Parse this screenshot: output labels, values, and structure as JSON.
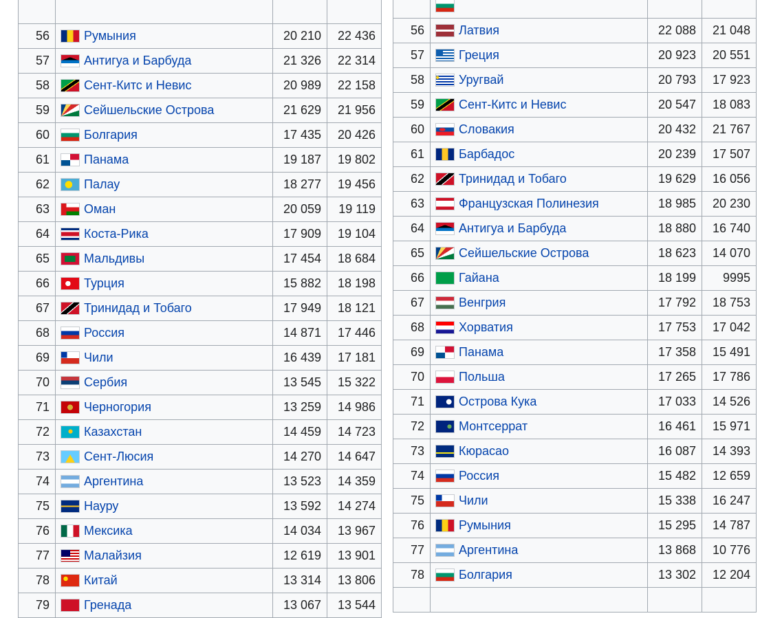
{
  "left_table": {
    "rows": [
      {
        "rank": "",
        "country": "",
        "v1": "",
        "v2": "",
        "flag": "none"
      },
      {
        "rank": "56",
        "country": "Румыния",
        "v1": "20 210",
        "v2": "22 436",
        "flag": "linear-gradient(90deg,#002b7f 33.3%,#fcd116 33.3% 66.6%,#ce1126 66.6%)"
      },
      {
        "rank": "57",
        "country": "Антигуа и Барбуда",
        "v1": "21 326",
        "v2": "22 314",
        "flag": "linear-gradient(160deg,#ce1126 30%,transparent 30%),linear-gradient(200deg,#ce1126 30%,transparent 30%),linear-gradient(180deg,#000 45%,#0072c6 45% 70%,#fff 70%)"
      },
      {
        "rank": "58",
        "country": "Сент-Китс и Невис",
        "v1": "20 989",
        "v2": "22 158",
        "flag": "linear-gradient(145deg,#009e49 38%,#fcd116 38% 42%,#000 42% 58%,#fcd116 58% 62%,#ce1126 62%)"
      },
      {
        "rank": "59",
        "country": "Сейшельские Острова",
        "v1": "21 629",
        "v2": "21 956",
        "flag": "conic-gradient(from 0deg at 0% 100%,#003f87 0deg 22deg,#fcd856 22deg 40deg,#d62828 40deg 57deg,#fff 57deg 72deg,#007a3d 72deg 90deg)"
      },
      {
        "rank": "60",
        "country": "Болгария",
        "v1": "17 435",
        "v2": "20 426",
        "flag": "linear-gradient(180deg,#fff 33.3%,#00966e 33.3% 66.6%,#d62612 66.6%)"
      },
      {
        "rank": "61",
        "country": "Панама",
        "v1": "19 187",
        "v2": "19 802",
        "flag": "linear-gradient(90deg,#fff 50%,#d21034 50%) top/100% 50% no-repeat,linear-gradient(90deg,#005293 50%,#fff 50%) bottom/100% 50% no-repeat"
      },
      {
        "rank": "62",
        "country": "Палау",
        "v1": "18 277",
        "v2": "19 456",
        "flag": "radial-gradient(circle at 42% 50%,#ffde00 30%,#4aadd6 31%)"
      },
      {
        "rank": "63",
        "country": "Оман",
        "v1": "20 059",
        "v2": "19 119",
        "flag": "linear-gradient(90deg,#db161b 28%,transparent 28%),linear-gradient(180deg,#fff 33.3%,#db161b 33.3% 66.6%,#008000 66.6%)"
      },
      {
        "rank": "64",
        "country": "Коста-Рика",
        "v1": "17 909",
        "v2": "19 104",
        "flag": "linear-gradient(180deg,#002b7f 16.6%,#fff 16.6% 33.3%,#ce1126 33.3% 66.6%,#fff 66.6% 83.3%,#002b7f 83.3%)"
      },
      {
        "rank": "65",
        "country": "Мальдивы",
        "v1": "17 454",
        "v2": "18 684",
        "flag": "linear-gradient(#007e3a,#007e3a) center/60% 55% no-repeat,#d21034"
      },
      {
        "rank": "66",
        "country": "Турция",
        "v1": "15 882",
        "v2": "18 198",
        "flag": "radial-gradient(circle at 38% 50%,#fff 20%,transparent 21%),#e30a17"
      },
      {
        "rank": "67",
        "country": "Тринидад и Тобаго",
        "v1": "17 949",
        "v2": "18 121",
        "flag": "linear-gradient(140deg,#ce1126 36%,#fff 36% 40%,#000 40% 60%,#fff 60% 64%,#ce1126 64%)"
      },
      {
        "rank": "68",
        "country": "Россия",
        "v1": "14 871",
        "v2": "17 446",
        "flag": "linear-gradient(180deg,#fff 33.3%,#0039a6 33.3% 66.6%,#d52b1e 66.6%)"
      },
      {
        "rank": "69",
        "country": "Чили",
        "v1": "16 439",
        "v2": "17 181",
        "flag": "linear-gradient(90deg,#0039a6 33%,#fff 33%) top/100% 50% no-repeat,linear-gradient(#d52b1e,#d52b1e) bottom/100% 50% no-repeat"
      },
      {
        "rank": "70",
        "country": "Сербия",
        "v1": "13 545",
        "v2": "15 322",
        "flag": "linear-gradient(180deg,#c6363c 33.3%,#0c4076 33.3% 66.6%,#fff 66.6%)"
      },
      {
        "rank": "71",
        "country": "Черногория",
        "v1": "13 259",
        "v2": "14 986",
        "flag": "radial-gradient(circle at 50% 50%,#d4af37 25%,transparent 26%),#c40308"
      },
      {
        "rank": "72",
        "country": "Казахстан",
        "v1": "14 459",
        "v2": "14 723",
        "flag": "radial-gradient(circle at 52% 45%,#fec50c 18%,#00afca 19%)"
      },
      {
        "rank": "73",
        "country": "Сент-Люсия",
        "v1": "14 270",
        "v2": "14 647",
        "flag": "linear-gradient(180deg,transparent 30%,transparent 30%),conic-gradient(from 150deg at 50% 30%,#fcd116 0deg 60deg,#66ccff 60deg)"
      },
      {
        "rank": "74",
        "country": "Аргентина",
        "v1": "13 523",
        "v2": "14 359",
        "flag": "linear-gradient(180deg,#74acdf 33.3%,#fff 33.3% 66.6%,#74acdf 66.6%)"
      },
      {
        "rank": "75",
        "country": "Науру",
        "v1": "13 592",
        "v2": "14 274",
        "flag": "linear-gradient(180deg,#002b7f 45%,#ffc61e 45% 55%,#002b7f 55%)"
      },
      {
        "rank": "76",
        "country": "Мексика",
        "v1": "14 034",
        "v2": "13 967",
        "flag": "linear-gradient(90deg,#006847 33.3%,#fff 33.3% 66.6%,#ce1126 66.6%)"
      },
      {
        "rank": "77",
        "country": "Малайзия",
        "v1": "12 619",
        "v2": "13 901",
        "flag": "linear-gradient(#010066,#010066) top left/50% 57% no-repeat,repeating-linear-gradient(180deg,#cc0001 0 2px,#fff 2px 4px)"
      },
      {
        "rank": "78",
        "country": "Китай",
        "v1": "13 314",
        "v2": "13 806",
        "flag": "radial-gradient(circle at 25% 35%,#ffde00 14%,transparent 15%),#de2910"
      },
      {
        "rank": "79",
        "country": "Гренада",
        "v1": "13 067",
        "v2": "13 544",
        "flag": "linear-gradient(#ce1126,#ce1126)"
      }
    ]
  },
  "right_table": {
    "rows": [
      {
        "rank": "",
        "country": "",
        "v1": "",
        "v2": "",
        "flag": "linear-gradient(180deg,#fff 33.3%,#00966e 33.3% 66.6%,#d62612 66.6%)"
      },
      {
        "rank": "56",
        "country": "Латвия",
        "v1": "22 088",
        "v2": "21 048",
        "flag": "linear-gradient(180deg,#9e3039 40%,#fff 40% 60%,#9e3039 60%)"
      },
      {
        "rank": "57",
        "country": "Греция",
        "v1": "20 923",
        "v2": "20 551",
        "flag": "linear-gradient(#0d5eaf,#0d5eaf) top left/40% 55% no-repeat,repeating-linear-gradient(180deg,#0d5eaf 0 2px,#fff 2px 4px)"
      },
      {
        "rank": "58",
        "country": "Уругвай",
        "v1": "20 793",
        "v2": "17 923",
        "flag": "radial-gradient(circle at 18% 28%,#fcd116 14%,transparent 15%) top left/45% 100% no-repeat,repeating-linear-gradient(180deg,#fff 0 2px,#0038a8 2px 4px)"
      },
      {
        "rank": "59",
        "country": "Сент-Китс и Невис",
        "v1": "20 547",
        "v2": "18 083",
        "flag": "linear-gradient(145deg,#009e49 38%,#fcd116 38% 42%,#000 42% 58%,#fcd116 58% 62%,#ce1126 62%)"
      },
      {
        "rank": "60",
        "country": "Словакия",
        "v1": "20 432",
        "v2": "21 767",
        "flag": "radial-gradient(ellipse at 35% 50%,#ee1c25 18%,transparent 19%),linear-gradient(180deg,#fff 33.3%,#0b4ea2 33.3% 66.6%,#ee1c25 66.6%)"
      },
      {
        "rank": "61",
        "country": "Барбадос",
        "v1": "20 239",
        "v2": "17 507",
        "flag": "linear-gradient(90deg,#00267f 33.3%,#ffc726 33.3% 66.6%,#00267f 66.6%)"
      },
      {
        "rank": "62",
        "country": "Тринидад и Тобаго",
        "v1": "19 629",
        "v2": "16 056",
        "flag": "linear-gradient(140deg,#ce1126 36%,#fff 36% 40%,#000 40% 60%,#fff 60% 64%,#ce1126 64%)"
      },
      {
        "rank": "63",
        "country": "Французская Полинезия",
        "v1": "18 985",
        "v2": "20 230",
        "flag": "linear-gradient(180deg,#ce1126 25%,#fff 25% 75%,#ce1126 75%)"
      },
      {
        "rank": "64",
        "country": "Антигуа и Барбуда",
        "v1": "18 880",
        "v2": "16 740",
        "flag": "linear-gradient(160deg,#ce1126 30%,transparent 30%),linear-gradient(200deg,#ce1126 30%,transparent 30%),linear-gradient(180deg,#000 45%,#0072c6 45% 70%,#fff 70%)"
      },
      {
        "rank": "65",
        "country": "Сейшельские Острова",
        "v1": "18 623",
        "v2": "14 070",
        "flag": "conic-gradient(from 0deg at 0% 100%,#003f87 0deg 22deg,#fcd856 22deg 40deg,#d62828 40deg 57deg,#fff 57deg 72deg,#007a3d 72deg 90deg)"
      },
      {
        "rank": "66",
        "country": "Гайана",
        "v1": "18 199",
        "v2": "9995",
        "flag": "conic-gradient(from 60deg at 0% 50%,#009e49 0deg,#009e49 0deg),linear-gradient(90deg,#ce1126 20%,#fcd116 20% 70%,#009e49 70%)"
      },
      {
        "rank": "67",
        "country": "Венгрия",
        "v1": "17 792",
        "v2": "18 753",
        "flag": "linear-gradient(180deg,#ce2939 33.3%,#fff 33.3% 66.6%,#477050 66.6%)"
      },
      {
        "rank": "68",
        "country": "Хорватия",
        "v1": "17 753",
        "v2": "17 042",
        "flag": "linear-gradient(180deg,#ff0000 33.3%,#fff 33.3% 66.6%,#171796 66.6%)"
      },
      {
        "rank": "69",
        "country": "Панама",
        "v1": "17 358",
        "v2": "15 491",
        "flag": "linear-gradient(90deg,#fff 50%,#d21034 50%) top/100% 50% no-repeat,linear-gradient(90deg,#005293 50%,#fff 50%) bottom/100% 50% no-repeat"
      },
      {
        "rank": "70",
        "country": "Польша",
        "v1": "17 265",
        "v2": "17 786",
        "flag": "linear-gradient(180deg,#fff 50%,#dc143c 50%)"
      },
      {
        "rank": "71",
        "country": "Острова Кука",
        "v1": "17 033",
        "v2": "14 526",
        "flag": "radial-gradient(circle at 72% 50%,#fff 18%,transparent 20%),#00247d"
      },
      {
        "rank": "72",
        "country": "Монтсеррат",
        "v1": "16 461",
        "v2": "15 971",
        "flag": "radial-gradient(circle at 75% 50%,#66aa55 14%,transparent 15%),#00247d"
      },
      {
        "rank": "73",
        "country": "Кюрасао",
        "v1": "16 087",
        "v2": "14 393",
        "flag": "linear-gradient(180deg,#002b7f 60%,#f9e814 60% 72%,#002b7f 72%)"
      },
      {
        "rank": "74",
        "country": "Россия",
        "v1": "15 482",
        "v2": "12 659",
        "flag": "linear-gradient(180deg,#fff 33.3%,#0039a6 33.3% 66.6%,#d52b1e 66.6%)"
      },
      {
        "rank": "75",
        "country": "Чили",
        "v1": "15 338",
        "v2": "16 247",
        "flag": "linear-gradient(90deg,#0039a6 33%,#fff 33%) top/100% 50% no-repeat,linear-gradient(#d52b1e,#d52b1e) bottom/100% 50% no-repeat"
      },
      {
        "rank": "76",
        "country": "Румыния",
        "v1": "15 295",
        "v2": "14 787",
        "flag": "linear-gradient(90deg,#002b7f 33.3%,#fcd116 33.3% 66.6%,#ce1126 66.6%)"
      },
      {
        "rank": "77",
        "country": "Аргентина",
        "v1": "13 868",
        "v2": "10 776",
        "flag": "linear-gradient(180deg,#74acdf 33.3%,#fff 33.3% 66.6%,#74acdf 66.6%)"
      },
      {
        "rank": "78",
        "country": "Болгария",
        "v1": "13 302",
        "v2": "12 204",
        "flag": "linear-gradient(180deg,#fff 33.3%,#00966e 33.3% 66.6%,#d62612 66.6%)"
      },
      {
        "rank": "",
        "country": "",
        "v1": "",
        "v2": "",
        "flag": "none"
      }
    ]
  }
}
